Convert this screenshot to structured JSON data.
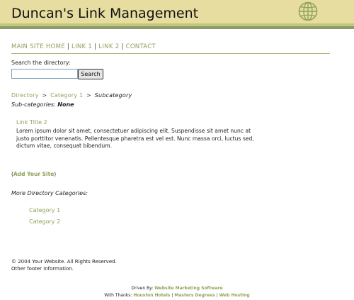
{
  "header": {
    "title": "Duncan's Link Management"
  },
  "nav": [
    {
      "label": "MAIN SITE HOME"
    },
    {
      "label": "LINK 1"
    },
    {
      "label": "LINK 2"
    },
    {
      "label": "CONTACT"
    }
  ],
  "nav_separator": "|",
  "search": {
    "label": "Search the directory:",
    "placeholder": "",
    "value": "",
    "button": "Search"
  },
  "breadcrumb": {
    "root": "Directory",
    "category": "Category 1",
    "current": "Subcategory",
    "arrow": ">"
  },
  "subcategories": {
    "label": "Sub-categories:",
    "value": "None"
  },
  "listing": {
    "title": "Link Title 2",
    "description": "Lorem ipsum dolor sit amet, consectetuer adipiscing elit. Suspendisse sit amet nunc at justo porttitor venenatis. Pellentesque pharetra est vel est. Nunc massa orci, luctus sed, dictum vitae, consequat bibendum."
  },
  "add_site": {
    "open": "(",
    "label": "Add Your Site",
    "close": ")"
  },
  "more_categories": {
    "heading": "More Directory Categories:",
    "items": [
      {
        "label": "Category 1"
      },
      {
        "label": "Category 2"
      }
    ]
  },
  "footer": {
    "line1": "© 2004 Your Website. All Rights Reserved.",
    "line2": "Other footer information."
  },
  "credits": {
    "driven_prefix": "Driven By:",
    "driven_link": "Website Marketing Software",
    "thanks_prefix": "With Thanks:",
    "thanks_links": [
      "Houston Hotels",
      "Masters Degrees",
      "Web Hosting"
    ],
    "separator": "|"
  },
  "colors": {
    "header_bg": "#e8dda0",
    "stripe_light": "#c4c97a",
    "stripe_dark": "#8c9a6e",
    "link": "#8fa25a",
    "globe": "#8fa25a"
  },
  "icons": {
    "header_logo": "globe-icon"
  }
}
